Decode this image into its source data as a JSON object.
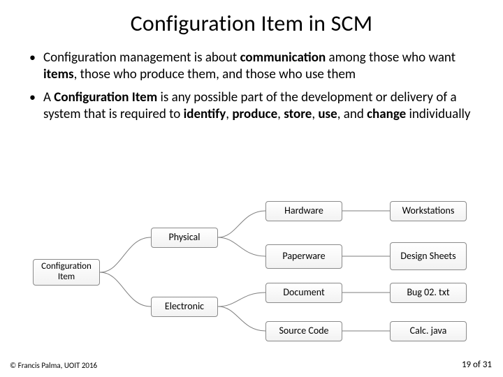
{
  "title": "Configuration Item in SCM",
  "bullets": {
    "b1_pre": "Configuration management is about ",
    "b1_communication": "communication",
    "b1_mid1": " among those who want ",
    "b1_items": "items",
    "b1_post": ", those who produce them, and those who use them",
    "b2_pre": "A ",
    "b2_cfgitem": "Configuration Item",
    "b2_mid": " is any possible part of the development or delivery of a system that is required to ",
    "b2_identify": "identify",
    "b2_s1": ", ",
    "b2_produce": "produce",
    "b2_s2": ", ",
    "b2_store": "store",
    "b2_s3": ", ",
    "b2_use": "use",
    "b2_s4": ", and ",
    "b2_change": "change",
    "b2_post": " individually"
  },
  "diagram": {
    "ci": "Configuration Item",
    "physical": "Physical",
    "electronic": "Electronic",
    "hardware": "Hardware",
    "paperware": "Paperware",
    "document": "Document",
    "source": "Source Code",
    "workstations": "Workstations",
    "design_sheets": "Design Sheets",
    "bug": "Bug 02. txt",
    "calc": "Calc. java"
  },
  "footer": {
    "left": "© Francis Palma, UOIT 2016",
    "right": "19 of 31"
  }
}
